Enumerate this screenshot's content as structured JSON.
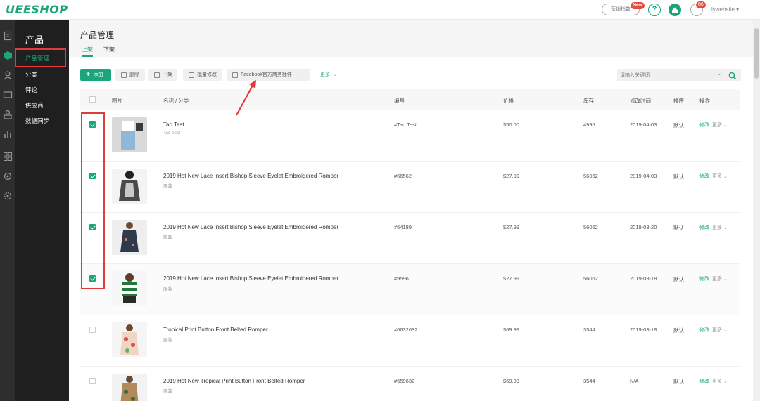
{
  "app": {
    "logo": "UEESHOP",
    "promo_label": "营销指数",
    "promo_badge": "New",
    "help_label": "?",
    "message_badge": "86",
    "user": "lywebsite"
  },
  "sidebar": {
    "title": "产品",
    "items": [
      {
        "label": "产品管理",
        "active": true
      },
      {
        "label": "分类"
      },
      {
        "label": "评论"
      },
      {
        "label": "供应商"
      },
      {
        "label": "数据同步"
      }
    ]
  },
  "page": {
    "title": "产品管理",
    "tabs": [
      {
        "label": "上架",
        "active": true
      },
      {
        "label": "下架"
      }
    ]
  },
  "toolbar": {
    "add": "添加",
    "delete": "删除",
    "unlist": "下架",
    "bulk_edit": "批量修改",
    "facebook": "Facebook官方商务插件",
    "more": "更多",
    "search_placeholder": "请输入关键词"
  },
  "table": {
    "columns": [
      "图片",
      "名称 / 分类",
      "编号",
      "价格",
      "库存",
      "修改时间",
      "排序",
      "操作"
    ],
    "rows": [
      {
        "name": "Tao Test",
        "category": "Tao Test",
        "sku": "#Tao Test",
        "price": "$50.00",
        "stock": "4995",
        "modified": "2019-04-03",
        "sort": "默认",
        "edit": "修改",
        "more": "更多 ⌄",
        "checked": true
      },
      {
        "name": "2019 Hot New Lace Insert Bishop Sleeve Eyelet Embroidered Romper",
        "category": "服装",
        "sku": "#66562",
        "price": "$27.99",
        "stock": "56062",
        "modified": "2019-04-03",
        "sort": "默认",
        "edit": "修改",
        "more": "更多 ⌄",
        "checked": true
      },
      {
        "name": "2019 Hot New Lace Insert Bishop Sleeve Eyelet Embroidered Romper",
        "category": "服装",
        "sku": "#64189",
        "price": "$27.99",
        "stock": "56062",
        "modified": "2019-03-20",
        "sort": "默认",
        "edit": "修改",
        "more": "更多 ⌄",
        "checked": true
      },
      {
        "name": "2019 Hot New Lace Insert Bishop Sleeve Eyelet Embroidered Romper",
        "category": "服装",
        "sku": "#9596",
        "price": "$27.99",
        "stock": "56062",
        "modified": "2019-03-18",
        "sort": "默认",
        "edit": "修改",
        "more": "更多 ⌄",
        "checked": true
      },
      {
        "name": "Tropical Print Button Front Belted Romper",
        "category": "服装",
        "sku": "#6632632",
        "price": "$69.99",
        "stock": "3544",
        "modified": "2019-03-18",
        "sort": "默认",
        "edit": "修改",
        "more": "更多 ⌄",
        "checked": false
      },
      {
        "name": "2019 Hot New Tropical Print Button Front Belted Romper",
        "category": "服装",
        "sku": "#659632",
        "price": "$69.99",
        "stock": "3544",
        "modified": "N/A",
        "sort": "默认",
        "edit": "修改",
        "more": "更多 ⌄",
        "checked": false
      }
    ]
  },
  "colors": {
    "brand": "#1aa57b",
    "annotation": "#e23b3b"
  }
}
